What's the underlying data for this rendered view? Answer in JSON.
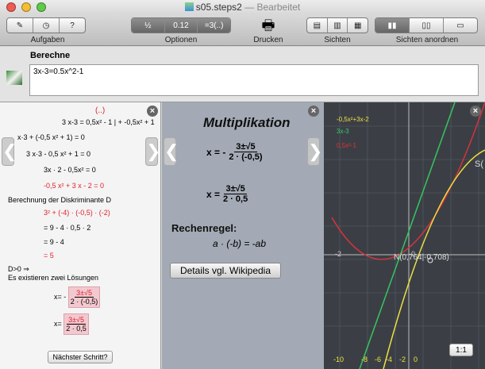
{
  "window": {
    "title": "s05.steps2",
    "subtitle": "— Bearbeitet"
  },
  "toolbar": {
    "aufgaben": "Aufgaben",
    "optionen": "Optionen",
    "drucken": "Drucken",
    "sichten": "Sichten",
    "sichten_anordnen": "Sichten anordnen",
    "precision": "0.12",
    "mode": "=3(..)"
  },
  "input": {
    "label": "Berechne",
    "value": "3x-3=0.5x^2-1"
  },
  "steps": {
    "annotation": "(..)",
    "line1": "3 x-3 = 0,5x² - 1 | + -0,5x² + 1",
    "line2": "x·3 + (-0,5 x² + 1) = 0",
    "line3": "3 x·3 - 0,5 x² + 1 = 0",
    "line4": "3x · 2 - 0,5x² = 0",
    "line5": "-0,5 x² + 3 x - 2 = 0",
    "discr_title": "Berechnung der Diskriminante D",
    "d1": "3² + (-4) · (-0,5) · (-2)",
    "d2": "= 9 - 4 · 0,5 · 2",
    "d3": "= 9 - 4",
    "d4": "= 5",
    "d_pos": "D>0 ⇒",
    "two_solutions": "Es existieren zwei Lösungen",
    "sol1_num": "3±√5",
    "sol1_den": "2 · (-0,5)",
    "sol2_num": "3±√5",
    "sol2_den": "2 · 0,5",
    "next_button": "Nächster Schritt?"
  },
  "middle": {
    "title": "Multiplikation",
    "eq1_lhs": "x = -",
    "eq1_num": "3±√5",
    "eq1_den": "2 · (-0,5)",
    "eq2_lhs": "x =",
    "eq2_num": "3±√5",
    "eq2_den": "2 · 0,5",
    "rule_title": "Rechenregel:",
    "rule": "a · (-b) = -ab",
    "wiki_button": "Details vgl. Wikipedia"
  },
  "graph": {
    "legend": [
      {
        "label": "-0,5x²+3x-2",
        "color": "#f0e040"
      },
      {
        "label": "3x-3",
        "color": "#3ec86a"
      },
      {
        "label": "0,5x²-1",
        "color": "#e0303a"
      }
    ],
    "point_label": "N(0,764|-0,708)",
    "s_label": "S(",
    "x_ticks": [
      "-2",
      "0",
      "-10",
      "-8",
      "-6",
      "-4",
      "-2",
      "0"
    ],
    "zoom_button": "1:1"
  }
}
